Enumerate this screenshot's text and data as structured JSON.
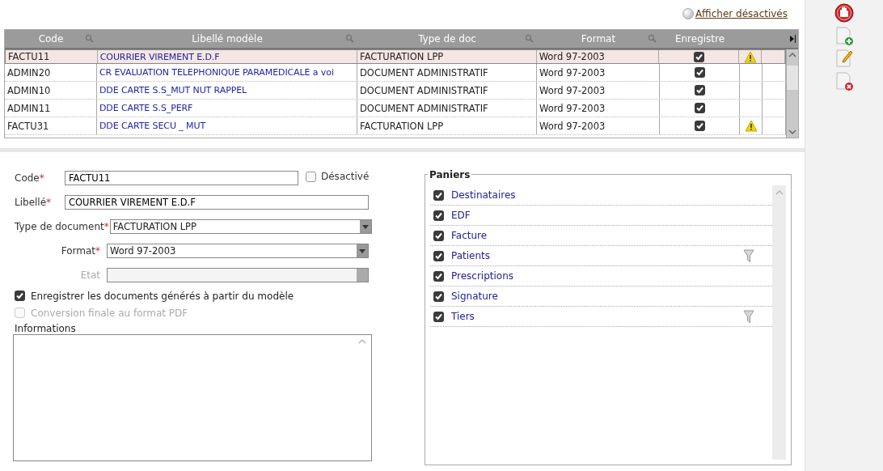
{
  "toolbar_link": {
    "label": "Afficher désactivés",
    "checked": false
  },
  "table": {
    "columns": [
      {
        "label": "Code",
        "searchable": true
      },
      {
        "label": "Libellé modèle",
        "searchable": true
      },
      {
        "label": "Type de doc",
        "searchable": true
      },
      {
        "label": "Format",
        "searchable": true
      },
      {
        "label": "Enregistre",
        "searchable": false
      }
    ],
    "rows": [
      {
        "code": "FACTU11",
        "label": "COURRIER VIREMENT E.D.F",
        "type": "FACTURATION LPP",
        "format": "Word 97-2003",
        "saved": true,
        "warning": true,
        "selected": true
      },
      {
        "code": "ADMIN20",
        "label": "CR EVALUATION TELEPHONIQUE PARAMEDICALE a voi",
        "type": "DOCUMENT ADMINISTRATIF",
        "format": "Word 97-2003",
        "saved": true,
        "warning": false,
        "selected": false
      },
      {
        "code": "ADMIN10",
        "label": "DDE CARTE S.S_MUT NUT RAPPEL",
        "type": "DOCUMENT ADMINISTRATIF",
        "format": "Word 97-2003",
        "saved": true,
        "warning": false,
        "selected": false
      },
      {
        "code": "ADMIN11",
        "label": "DDE CARTE S.S_PERF",
        "type": "DOCUMENT ADMINISTRATIF",
        "format": "Word 97-2003",
        "saved": true,
        "warning": false,
        "selected": false
      },
      {
        "code": "FACTU31",
        "label": "DDE CARTE SECU _ MUT",
        "type": "FACTURATION LPP",
        "format": "Word 97-2003",
        "saved": true,
        "warning": true,
        "selected": false
      }
    ]
  },
  "form": {
    "code": {
      "label": "Code",
      "required_mark": "*",
      "value": "FACTU11"
    },
    "disabled_box": {
      "label": "Désactivé",
      "checked": false
    },
    "libelle": {
      "label": "Libellé",
      "required_mark": "*",
      "value": "COURRIER VIREMENT E.D.F"
    },
    "type": {
      "label": "Type de document",
      "required_mark": "*",
      "value": "FACTURATION LPP"
    },
    "format": {
      "label": "Format",
      "required_mark": "*",
      "value": "Word 97-2003"
    },
    "etat": {
      "label": "Etat",
      "disabled": true
    },
    "options": [
      {
        "label": "Enregistrer les documents générés à partir du modèle",
        "checked": true,
        "disabled": false
      },
      {
        "label": "Conversion finale au format PDF",
        "checked": false,
        "disabled": true
      }
    ],
    "informations": {
      "label": "Informations"
    }
  },
  "paniers": {
    "title": "Paniers",
    "items": [
      {
        "label": "Destinataires",
        "checked": true,
        "filter": false
      },
      {
        "label": "EDF",
        "checked": true,
        "filter": false
      },
      {
        "label": "Facture",
        "checked": true,
        "filter": false
      },
      {
        "label": "Patients",
        "checked": true,
        "filter": true
      },
      {
        "label": "Prescriptions",
        "checked": true,
        "filter": false
      },
      {
        "label": "Signature",
        "checked": true,
        "filter": false
      },
      {
        "label": "Tiers",
        "checked": true,
        "filter": true
      }
    ]
  },
  "side_tools": [
    {
      "kind": "stop"
    },
    {
      "kind": "add"
    },
    {
      "kind": "edit"
    },
    {
      "kind": "delete"
    }
  ]
}
